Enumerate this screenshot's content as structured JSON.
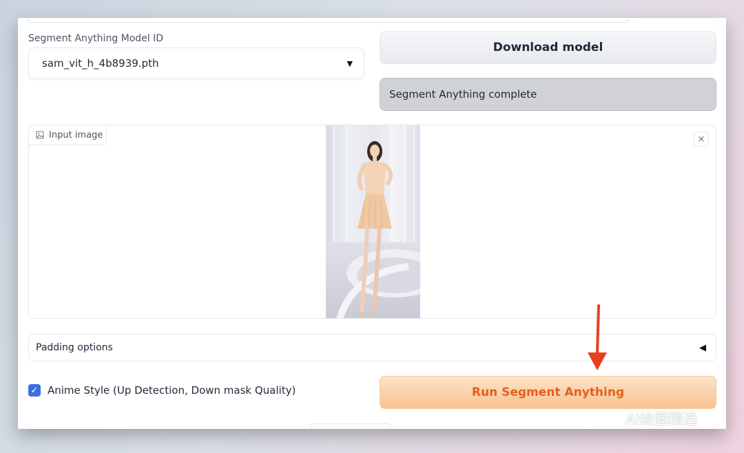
{
  "model_section": {
    "label": "Segment Anything Model ID",
    "selected_model": "sam_vit_h_4b8939.pth",
    "download_button": "Download model",
    "status_text": "Segment Anything complete"
  },
  "image_panel": {
    "label": "Input image",
    "close_icon": "×"
  },
  "padding_options": {
    "label": "Padding options",
    "toggle_icon": "◀"
  },
  "anime_style": {
    "label": "Anime Style (Up Detection, Down mask Quality)",
    "checked": true,
    "check_glyph": "✓"
  },
  "run_button": "Run Segment Anything",
  "watermark": "AI绘图精选",
  "colors": {
    "accent_blue": "#3b6fe0",
    "run_text": "#e3611b",
    "annotation_arrow": "#e8401e"
  }
}
